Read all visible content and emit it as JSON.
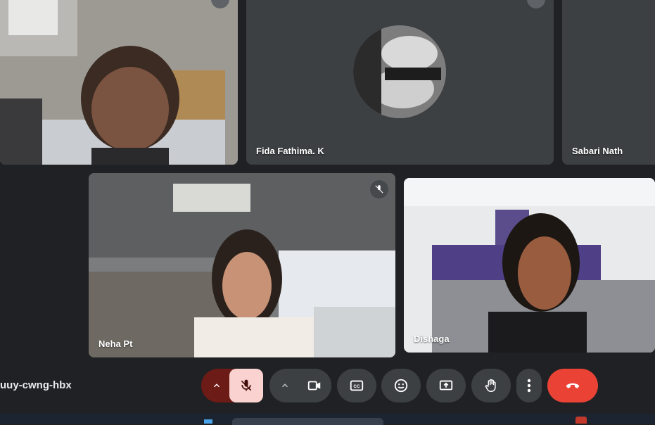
{
  "participants": [
    {
      "name": ""
    },
    {
      "name": "Fida Fathima. K"
    },
    {
      "name": "Sabari Nath"
    },
    {
      "name": "Neha Pt"
    },
    {
      "name": "Dishaga"
    }
  ],
  "meeting": {
    "code": "uuy-cwng-hbx"
  },
  "icons": {
    "mic": "mic-off-icon",
    "camera": "videocam-icon",
    "captions": "closed-caption-icon",
    "emoji": "emoji-icon",
    "present": "present-screen-icon",
    "hand": "raise-hand-icon",
    "more": "more-vert-icon",
    "end": "call-end-icon"
  },
  "colors": {
    "background": "#202124",
    "tile": "#3c4043",
    "mic_muted_bg": "#fad2cf",
    "mic_muted_dark": "#8c1d18",
    "end_call": "#ea4335"
  }
}
